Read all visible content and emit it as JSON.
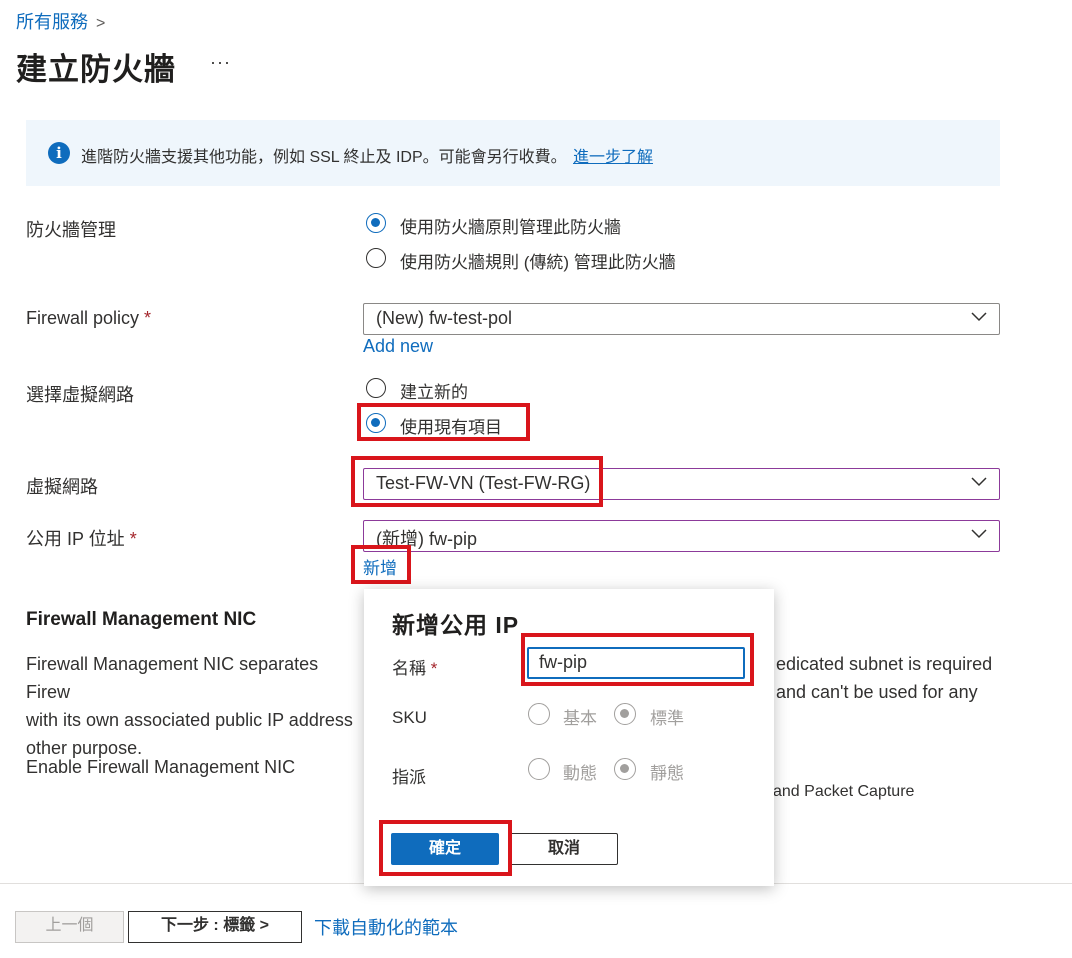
{
  "breadcrumb": {
    "root": "所有服務",
    "chevron": ">"
  },
  "page": {
    "title": "建立防火牆",
    "more": "···"
  },
  "info": {
    "text": "進階防火牆支援其他功能，例如 SSL 終止及 IDP。可能會另行收費。",
    "link": "進一步了解",
    "icon": "info-icon"
  },
  "management": {
    "label": "防火牆管理",
    "options": [
      "使用防火牆原則管理此防火牆",
      "使用防火牆規則 (傳統) 管理此防火牆"
    ],
    "selected": 0
  },
  "policy": {
    "label": "Firewall policy",
    "required": "*",
    "value": "(New) fw-test-pol",
    "add_new": "Add new"
  },
  "vnet_choice": {
    "label": "選擇虛擬網路",
    "options": [
      "建立新的",
      "使用現有項目"
    ],
    "selected": 1
  },
  "vnet": {
    "label": "虛擬網路",
    "value": "Test-FW-VN (Test-FW-RG)"
  },
  "public_ip": {
    "label": "公用 IP 位址",
    "required": "*",
    "value": "(新增) fw-pip",
    "add_new": "新增"
  },
  "mgmt_nic": {
    "title": "Firewall Management NIC",
    "desc_left": [
      "Firewall Management NIC separates Firew",
      "with its own associated public IP address",
      "other purpose."
    ],
    "desc_right": [
      "edicated subnet is required",
      "and can't be used for any"
    ],
    "enable_label": "Enable Firewall Management NIC",
    "enable_hint": "and Packet Capture"
  },
  "popup": {
    "title": "新增公用 IP",
    "name_label": "名稱",
    "name_required": "*",
    "name_value": "fw-pip",
    "sku_label": "SKU",
    "sku_options": [
      "基本",
      "標準"
    ],
    "sku_selected": 1,
    "assign_label": "指派",
    "assign_options": [
      "動態",
      "靜態"
    ],
    "assign_selected": 1,
    "ok": "確定",
    "cancel": "取消"
  },
  "footer": {
    "prev": "上一個",
    "next": "下一步 : 標籤 >",
    "template": "下載自動化的範本"
  },
  "colors": {
    "accent": "#0f6cbd",
    "highlight": "#d9151b",
    "info_bg": "#eff6fc"
  }
}
